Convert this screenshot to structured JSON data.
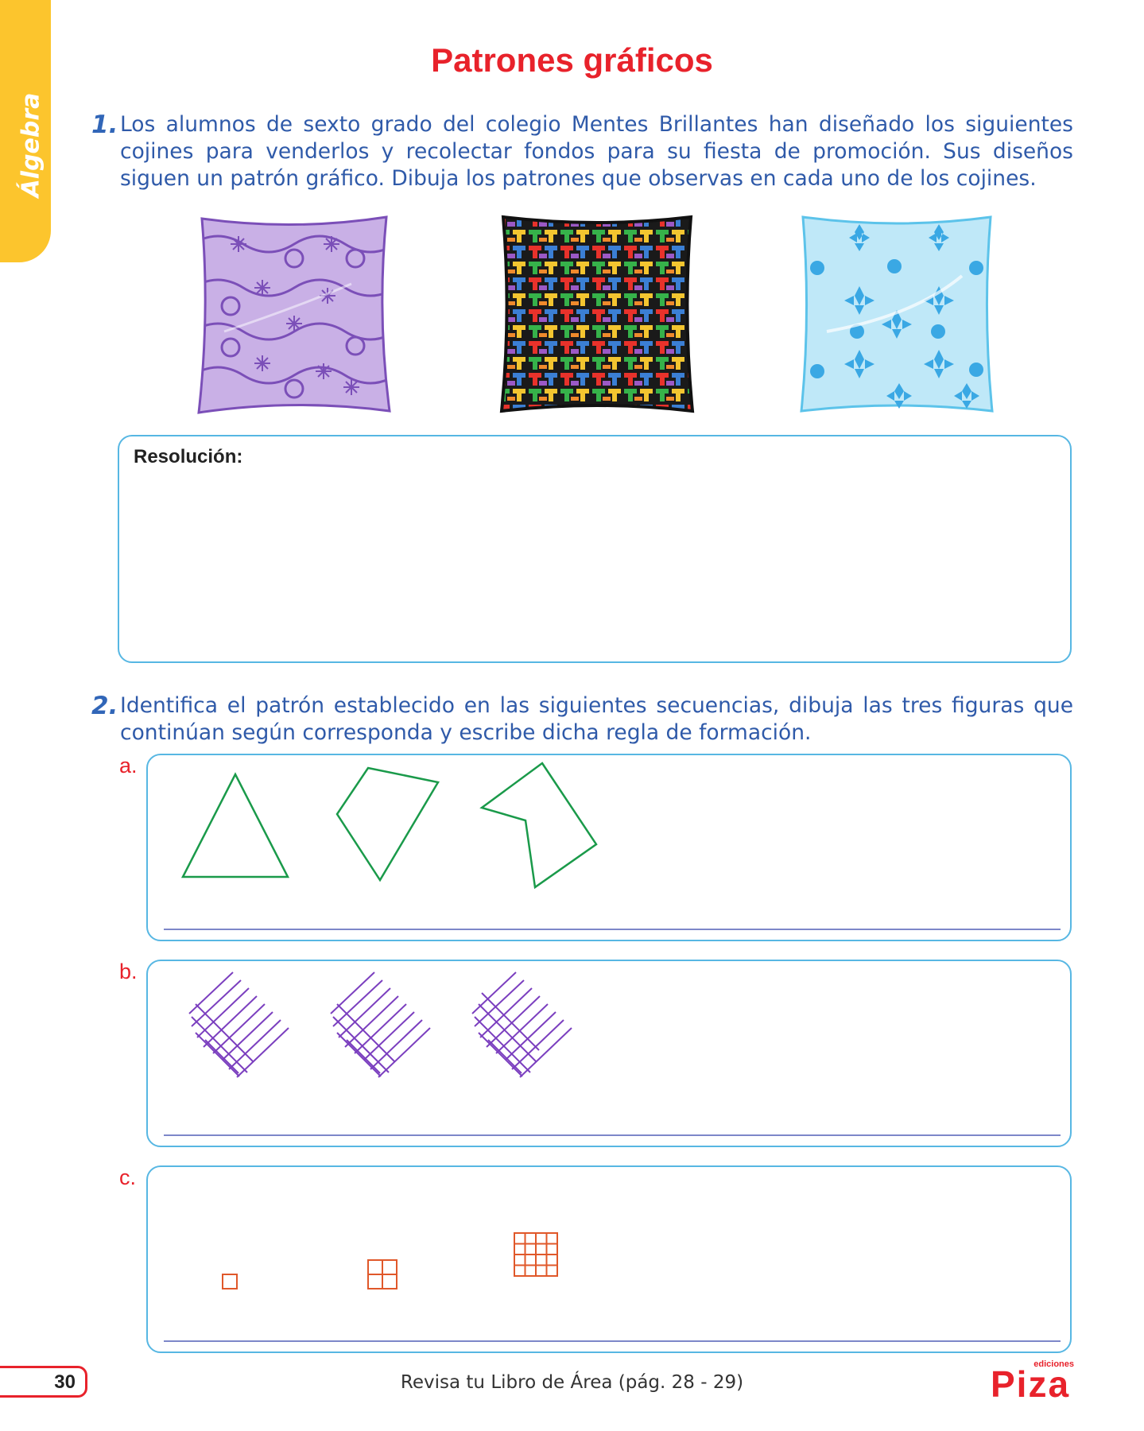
{
  "side_tab": {
    "label": "Álgebra",
    "color": "#fcc52d"
  },
  "title": "Patrones gráficos",
  "question1": {
    "number": "1.",
    "text": "Los alumnos de sexto grado del colegio Mentes Brillantes han diseñado los siguientes cojines para venderlos y recolectar fondos para su fiesta de promoción. Sus diseños siguen un patrón gráfico. Dibuja los patrones que observas en cada uno de los cojines.",
    "pillows": [
      "purple-pillow",
      "multicolor-pillow",
      "light-blue-pillow"
    ],
    "resolution_label": "Resolución:"
  },
  "question2": {
    "number": "2.",
    "text": "Identifica el patrón establecido en las siguientes secuencias, dibuja las tres figuras que continúan según corresponda y escribe dicha regla de formación.",
    "sequences": [
      {
        "letter": "a.",
        "description": "green polygons",
        "color": "#1a9a4a"
      },
      {
        "letter": "b.",
        "description": "purple crossed line grids",
        "color": "#7b3fbf"
      },
      {
        "letter": "c.",
        "description": "orange square grids 1x1, 2x2, 4x4",
        "color": "#e0582a"
      }
    ]
  },
  "footer": {
    "page_number": "30",
    "text": "Revisa tu Libro de Área (pág. 28 - 29)",
    "logo_small": "ediciones",
    "logo_main": "Piza"
  },
  "colors": {
    "title": "#e8222b",
    "question": "#2f5aa9",
    "border": "#57b7e3"
  }
}
